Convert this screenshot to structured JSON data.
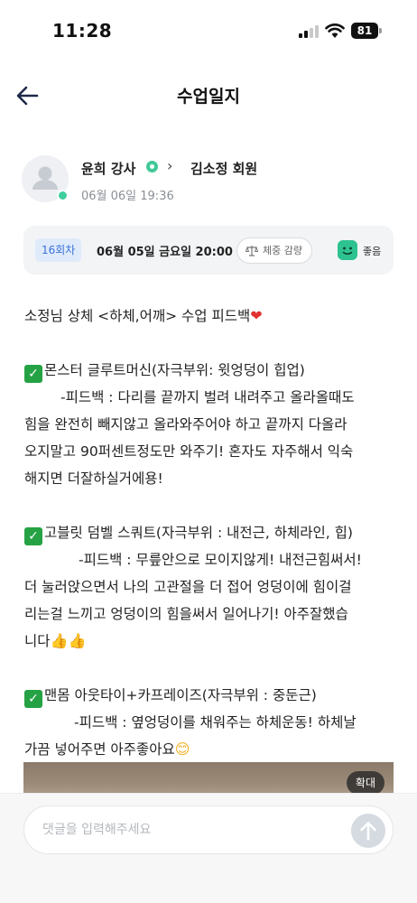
{
  "status_bar": {
    "time": "11:28",
    "battery": "81"
  },
  "header": {
    "title": "수업일지"
  },
  "author": {
    "trainer": "윤희 강사",
    "member": "김소정 회원",
    "date": "06월 06일 19:36"
  },
  "info": {
    "session": "16회차",
    "class_date": "06월 05일 금요일 20:00",
    "goal": "체중 감량",
    "mood": "좋음"
  },
  "content": {
    "intro": "소정님 상체 <하체,어깨> 수업 피드백",
    "ex1_title": "몬스터 글루트머신(자극부위: 윗엉덩이 힙업)",
    "ex1_line1": "-피드백 : 다리를 끝까지 벌려 내려주고 올라올때도",
    "ex1_line2": "힘을 완전히 빼지않고 올라와주어야 하고 끝까지 다올라",
    "ex1_line3": "오지말고 90퍼센트정도만 와주기! 혼자도 자주해서 익숙",
    "ex1_line4": "해지면 더잘하실거에용!",
    "ex2_title": "고블릿 덤벨 스쿼트(자극부위 : 내전근, 하체라인, 힙)",
    "ex2_line1": "-피드백 : 무릎안으로 모이지않게! 내전근힘써서!",
    "ex2_line2": "더 눌러앉으면서 나의 고관절을 더 접어 엉덩이에 힘이걸",
    "ex2_line3": "리는걸 느끼고 엉덩이의 힘을써서 일어나기! 아주잘했습",
    "ex2_line4": "니다",
    "ex3_title": "맨몸 아웃타이+카프레이즈(자극부위 : 중둔근)",
    "ex3_line1": "-피드백 : 옆엉덩이를 채워주는 하체운동! 하체날",
    "ex3_line2": "가끔 넣어주면 아주좋아요"
  },
  "image": {
    "zoom_label": "확대"
  },
  "comment": {
    "placeholder": "댓글을 입력해주세요"
  },
  "colors": {
    "accent_green": "#3fcf9e",
    "badge_blue": "#3a72d6",
    "check_green": "#25a244"
  }
}
